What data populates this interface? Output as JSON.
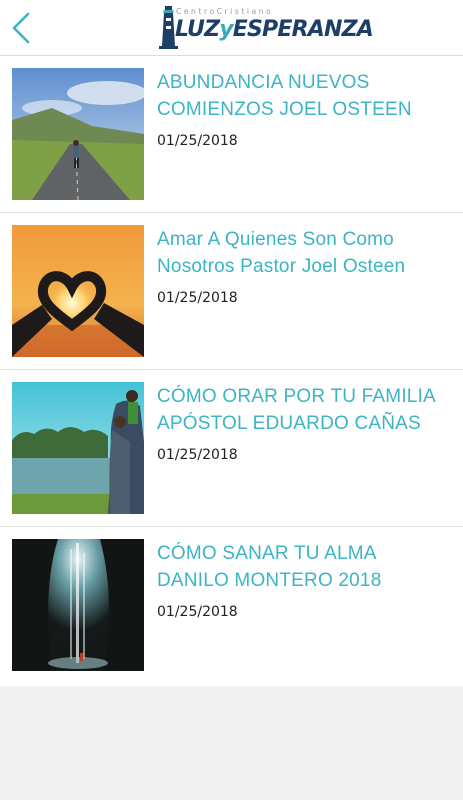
{
  "header": {
    "back_icon": "chevron-left-icon",
    "logo": {
      "small": "CentroCristiano",
      "main_left": "LUZ",
      "main_mark": "y",
      "main_right": "ESPERANZA"
    }
  },
  "colors": {
    "accent": "#3bb4c4",
    "logo_navy": "#1d3e66",
    "background": "#f1f1f1"
  },
  "items": [
    {
      "title": "ABUNDANCIA NUEVOS COMIENZOS JOEL OSTEEN",
      "date": "01/25/2018",
      "image": "person-on-road-image"
    },
    {
      "title": "Amar A Quienes Son Como Nosotros Pastor Joel Osteen",
      "date": "01/25/2018",
      "image": "heart-hands-sunset-image"
    },
    {
      "title": "CÓMO ORAR POR TU FAMILIA APÓSTOL EDUARDO CAÑAS",
      "date": "01/25/2018",
      "image": "family-by-lake-image"
    },
    {
      "title": "CÓMO SANAR TU ALMA DANILO MONTERO 2018",
      "date": "01/25/2018",
      "image": "cave-waterfall-image"
    }
  ]
}
